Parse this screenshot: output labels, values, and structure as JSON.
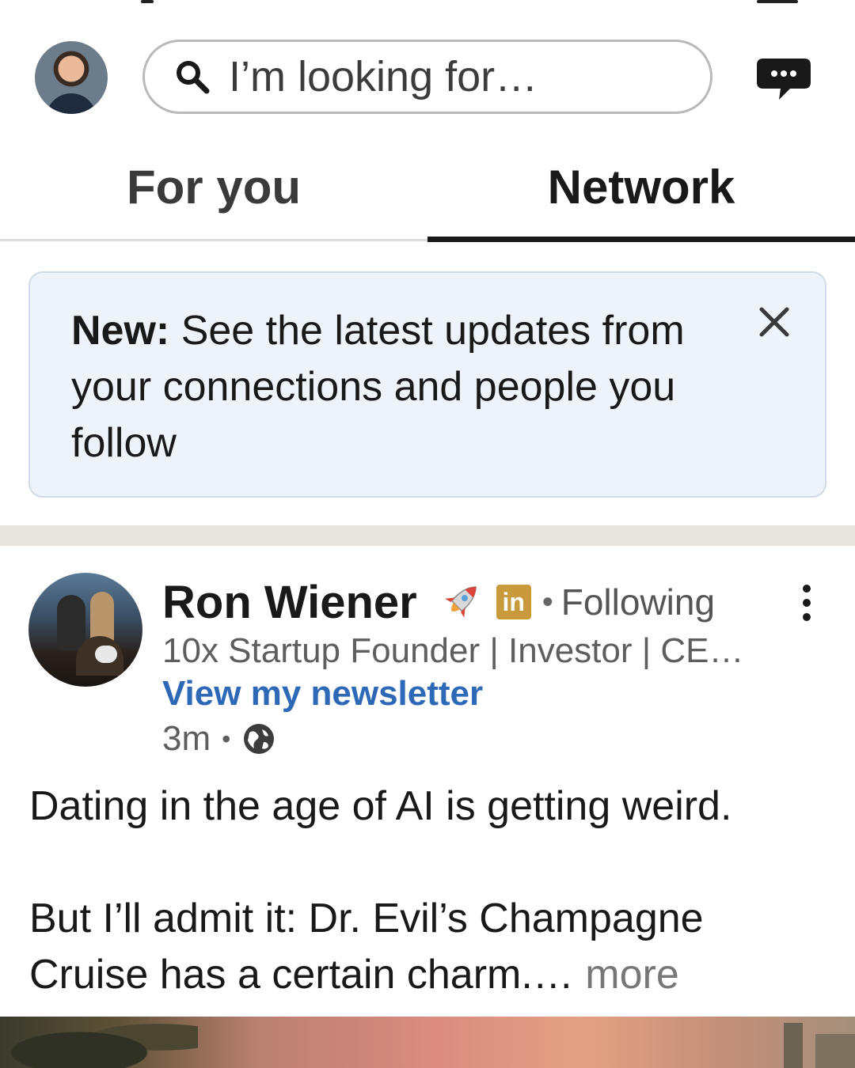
{
  "header": {
    "search": {
      "placeholder": "I’m looking for…"
    }
  },
  "tabs": [
    {
      "label": "For you",
      "selected": false
    },
    {
      "label": "Network",
      "selected": true
    }
  ],
  "banner": {
    "bold": "New:",
    "text": " See the latest updates from your connections and people you follow"
  },
  "post": {
    "author": "Ron Wiener",
    "badge": "in",
    "follow_dot": "•",
    "follow_status": "Following",
    "headline": "10x Startup Founder | Investor | CE…",
    "newsletter": "View my newsletter",
    "time": "3m",
    "meta_dot": "•",
    "visibility_icon": "globe-icon",
    "body": {
      "line1": "Dating in the age of AI is getting weird.",
      "line2": "But I’ll admit it: Dr. Evil’s Champagne Cruise has a certain charm.…",
      "more": " more"
    }
  },
  "colors": {
    "link": "#2e69b7",
    "banner_bg": "#edf3f8",
    "linkedin_badge": "#c99a3c",
    "tab_indicator": "#191919"
  }
}
